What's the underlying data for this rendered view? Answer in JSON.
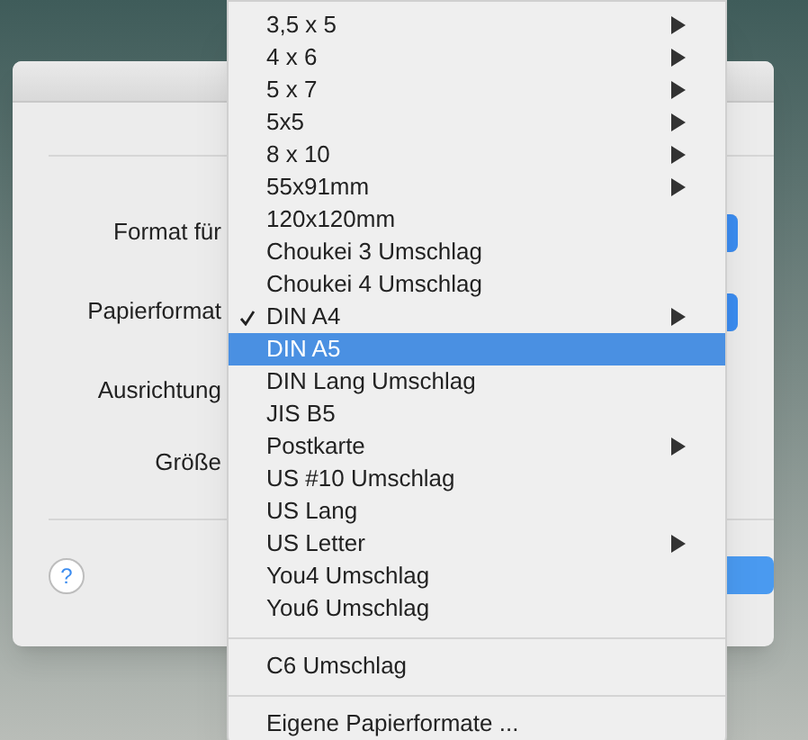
{
  "dialog": {
    "fields": [
      {
        "label": "Format für",
        "kind": "popup"
      },
      {
        "label": "Papierformat",
        "kind": "popup"
      },
      {
        "label": "Ausrichtung",
        "kind": "plain"
      },
      {
        "label": "Größe",
        "kind": "plain"
      }
    ],
    "help_button": "?"
  },
  "menu": {
    "items": [
      {
        "kind": "item",
        "label": "3,5 x 5",
        "submenu": true,
        "checked": false,
        "selected": false
      },
      {
        "kind": "item",
        "label": "4 x 6",
        "submenu": true,
        "checked": false,
        "selected": false
      },
      {
        "kind": "item",
        "label": "5 x 7",
        "submenu": true,
        "checked": false,
        "selected": false
      },
      {
        "kind": "item",
        "label": "5x5",
        "submenu": true,
        "checked": false,
        "selected": false
      },
      {
        "kind": "item",
        "label": "8 x 10",
        "submenu": true,
        "checked": false,
        "selected": false
      },
      {
        "kind": "item",
        "label": "55x91mm",
        "submenu": true,
        "checked": false,
        "selected": false
      },
      {
        "kind": "item",
        "label": "120x120mm",
        "submenu": false,
        "checked": false,
        "selected": false
      },
      {
        "kind": "item",
        "label": "Choukei 3 Umschlag",
        "submenu": false,
        "checked": false,
        "selected": false
      },
      {
        "kind": "item",
        "label": "Choukei 4 Umschlag",
        "submenu": false,
        "checked": false,
        "selected": false
      },
      {
        "kind": "item",
        "label": "DIN A4",
        "submenu": true,
        "checked": true,
        "selected": false
      },
      {
        "kind": "item",
        "label": "DIN A5",
        "submenu": false,
        "checked": false,
        "selected": true
      },
      {
        "kind": "item",
        "label": "DIN Lang Umschlag",
        "submenu": false,
        "checked": false,
        "selected": false
      },
      {
        "kind": "item",
        "label": "JIS B5",
        "submenu": false,
        "checked": false,
        "selected": false
      },
      {
        "kind": "item",
        "label": "Postkarte",
        "submenu": true,
        "checked": false,
        "selected": false
      },
      {
        "kind": "item",
        "label": "US #10 Umschlag",
        "submenu": false,
        "checked": false,
        "selected": false
      },
      {
        "kind": "item",
        "label": "US Lang",
        "submenu": false,
        "checked": false,
        "selected": false
      },
      {
        "kind": "item",
        "label": "US Letter",
        "submenu": true,
        "checked": false,
        "selected": false
      },
      {
        "kind": "item",
        "label": "You4 Umschlag",
        "submenu": false,
        "checked": false,
        "selected": false
      },
      {
        "kind": "item",
        "label": "You6 Umschlag",
        "submenu": false,
        "checked": false,
        "selected": false
      },
      {
        "kind": "separator"
      },
      {
        "kind": "item",
        "label": "C6 Umschlag",
        "submenu": false,
        "checked": false,
        "selected": false
      },
      {
        "kind": "separator"
      },
      {
        "kind": "item",
        "label": "Eigene Papierformate ...",
        "submenu": false,
        "checked": false,
        "selected": false
      }
    ]
  }
}
